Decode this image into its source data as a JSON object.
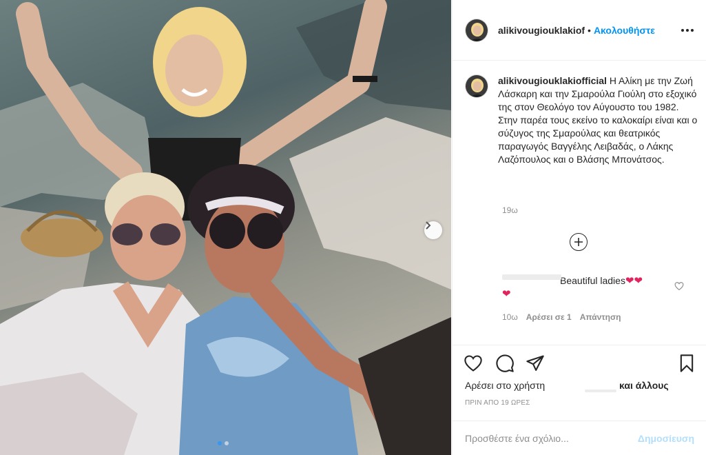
{
  "post": {
    "image_alt": "Three women posing outdoors on rocks, summer 1982",
    "carousel": {
      "dots": 2,
      "active_index": 0
    }
  },
  "header": {
    "username": "alikivougiouklakiof",
    "separator": "•",
    "follow_label": "Ακολουθήστε"
  },
  "caption": {
    "username": "alikivougiouklakiofficial",
    "text": " Η Αλίκη με την Ζωή Λάσκαρη και την Σμαρούλα Γιούλη στο εξοχικό της στον Θεολόγο τον Αύγουστο του 1982. Στην παρέα τους εκείνο το καλοκαίρι είναι και ο σύζυγος της Σμαρούλας και θεατρικός παραγωγός Βαγγέλης Λειβαδάς, ο Λάκης Λαζόπουλος και ο Βλάσης Μπονάτσος.",
    "time": "19ω"
  },
  "comment": {
    "text": "Beautiful ladies",
    "emoji": "❤❤",
    "emoji2": "❤",
    "time": "10ω",
    "likes": "Αρέσει σε 1",
    "reply": "Απάντηση"
  },
  "actions": {
    "liked_by_prefix": "Αρέσει στο χρήστη",
    "liked_by_suffix": "και άλλους",
    "post_time": "ΠΡΙΝ ΑΠΟ 19 ΩΡΕΣ"
  },
  "add_comment": {
    "placeholder": "Προσθέστε ένα σχόλιο...",
    "publish_label": "Δημοσίευση"
  },
  "colors": {
    "accent": "#0095f6",
    "publish_disabled": "#b2dffc",
    "muted": "#8e8e8e",
    "heart": "#e0245e"
  },
  "icons": [
    "more-icon",
    "chevron-right-icon",
    "add-circle-icon",
    "heart-icon",
    "comment-icon",
    "share-icon",
    "bookmark-icon"
  ]
}
